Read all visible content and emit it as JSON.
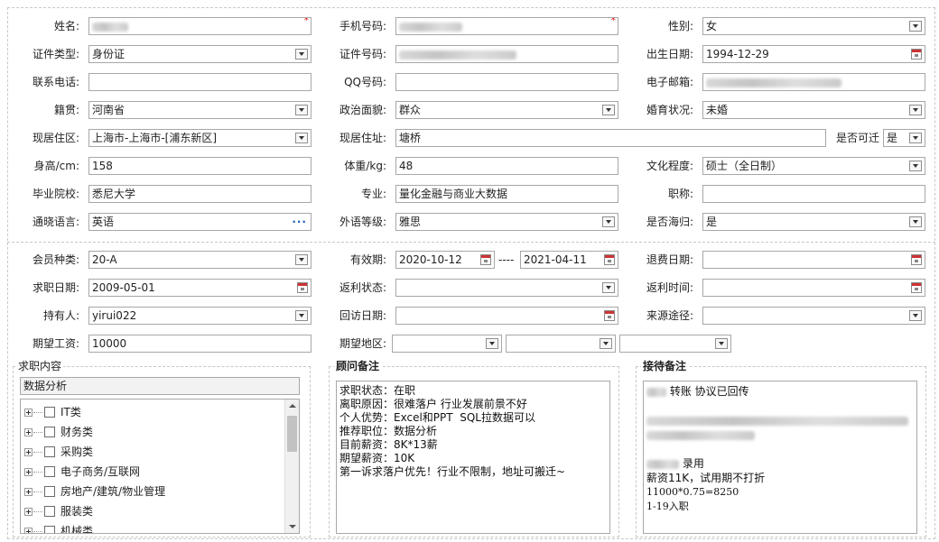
{
  "basic": {
    "name": {
      "label": "姓名:",
      "value": ""
    },
    "phone": {
      "label": "手机号码:",
      "value": ""
    },
    "gender": {
      "label": "性别:",
      "value": "女"
    },
    "id_type": {
      "label": "证件类型:",
      "value": "身份证"
    },
    "id_number": {
      "label": "证件号码:",
      "value": ""
    },
    "birth_date": {
      "label": "出生日期:",
      "value": "1994-12-29"
    },
    "contact_phone": {
      "label": "联系电话:",
      "value": ""
    },
    "qq": {
      "label": "QQ号码:",
      "value": ""
    },
    "email": {
      "label": "电子邮箱:",
      "value": ""
    },
    "native_place": {
      "label": "籍贯:",
      "value": "河南省"
    },
    "political_status": {
      "label": "政治面貌:",
      "value": "群众"
    },
    "marital_status": {
      "label": "婚育状况:",
      "value": "未婚"
    },
    "current_region": {
      "label": "现居住区:",
      "value": "上海市-上海市-[浦东新区]"
    },
    "current_address": {
      "label": "现居住址:",
      "value": "塘桥"
    },
    "relocate": {
      "label": "是否可迁",
      "value": "是"
    },
    "height": {
      "label": "身高/cm:",
      "value": "158"
    },
    "weight": {
      "label": "体重/kg:",
      "value": "48"
    },
    "education": {
      "label": "文化程度:",
      "value": "硕士（全日制）"
    },
    "school": {
      "label": "毕业院校:",
      "value": "悉尼大学"
    },
    "major": {
      "label": "专业:",
      "value": "量化金融与商业大数据"
    },
    "title": {
      "label": "职称:",
      "value": ""
    },
    "language": {
      "label": "通晓语言:",
      "value": "英语"
    },
    "lang_level": {
      "label": "外语等级:",
      "value": "雅思"
    },
    "returnee": {
      "label": "是否海归:",
      "value": "是"
    }
  },
  "member": {
    "member_type": {
      "label": "会员种类:",
      "value": "20-A"
    },
    "validity": {
      "label": "有效期:",
      "from": "2020-10-12",
      "separator": "----",
      "to": "2021-04-11"
    },
    "refund_date": {
      "label": "退费日期:",
      "value": ""
    },
    "job_seek_date": {
      "label": "求职日期:",
      "value": "2009-05-01"
    },
    "rebate_status": {
      "label": "返利状态:",
      "value": ""
    },
    "rebate_time": {
      "label": "返利时间:",
      "value": ""
    },
    "holder": {
      "label": "持有人:",
      "value": "yirui022"
    },
    "revisit_date": {
      "label": "回访日期:",
      "value": ""
    },
    "source": {
      "label": "来源途径:",
      "value": ""
    },
    "expected_salary": {
      "label": "期望工资:",
      "value": "10000"
    },
    "expected_region": {
      "label": "期望地区:",
      "values": [
        "",
        "",
        ""
      ]
    }
  },
  "job_content": {
    "title": "求职内容",
    "search_value": "数据分析",
    "tree": [
      "IT类",
      "财务类",
      "采购类",
      "电子商务/互联网",
      "房地产/建筑/物业管理",
      "服装类",
      "机械类"
    ]
  },
  "consultant_notes": {
    "title": "顾问备注",
    "text": "求职状态：在职\n离职原因：很难落户 行业发展前景不好\n个人优势：Excel和PPT  SQL拉数据可以\n推荐职位：数据分析\n目前薪资：8K*13薪\n期望薪资：10K\n第一诉求落户优先！行业不限制，地址可搬迁~"
  },
  "reception_notes": {
    "title": "接待备注",
    "line1": " 转账 协议已回传",
    "line2": " 录用",
    "line3": "薪资11K，试用期不打折",
    "line4": "11000*0.75=8250",
    "line5": "1-19入职"
  }
}
